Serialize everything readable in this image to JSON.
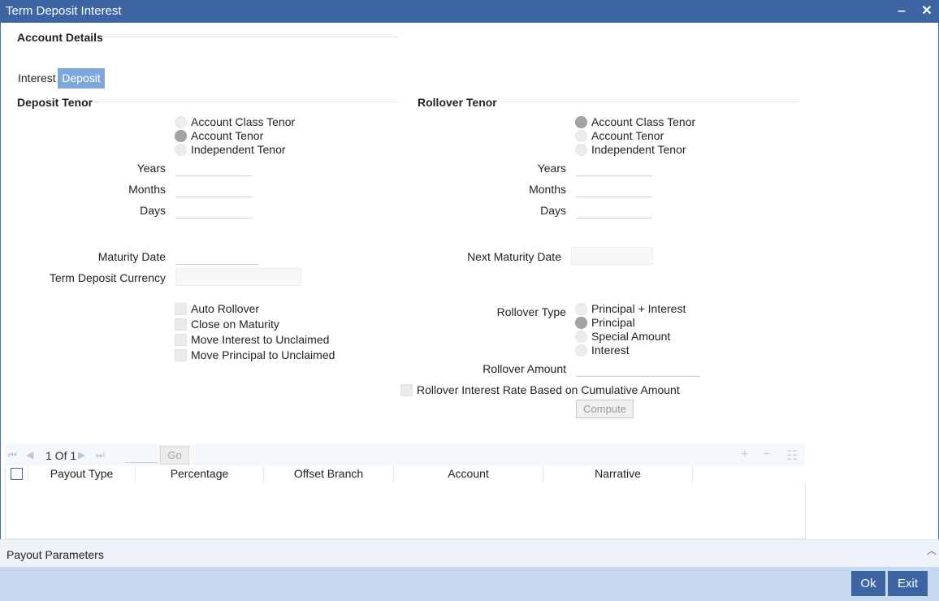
{
  "window": {
    "title": "Term Deposit Interest",
    "minimize": "‒",
    "close": "✕"
  },
  "account_details": {
    "heading": "Account Details"
  },
  "tabs": [
    {
      "label": "Interest"
    },
    {
      "label": "Deposit",
      "active": true
    }
  ],
  "deposit_tenor": {
    "heading": "Deposit Tenor",
    "options": [
      {
        "label": "Account Class Tenor",
        "selected": false
      },
      {
        "label": "Account Tenor",
        "selected": true
      },
      {
        "label": "Independent Tenor",
        "selected": false
      }
    ],
    "years_label": "Years",
    "months_label": "Months",
    "days_label": "Days",
    "years": "",
    "months": "",
    "days": ""
  },
  "rollover_tenor": {
    "heading": "Rollover Tenor",
    "options": [
      {
        "label": "Account Class Tenor",
        "selected": true
      },
      {
        "label": "Account Tenor",
        "selected": false
      },
      {
        "label": "Independent Tenor",
        "selected": false
      }
    ],
    "years_label": "Years",
    "months_label": "Months",
    "days_label": "Days",
    "years": "",
    "months": "",
    "days": ""
  },
  "maturity": {
    "maturity_date_label": "Maturity Date",
    "maturity_date": "",
    "currency_label": "Term Deposit Currency",
    "currency": "",
    "next_maturity_label": "Next Maturity Date",
    "next_maturity": ""
  },
  "checkboxes": [
    {
      "label": "Auto Rollover",
      "checked": false
    },
    {
      "label": "Close on Maturity",
      "checked": false
    },
    {
      "label": "Move Interest to Unclaimed",
      "checked": false
    },
    {
      "label": "Move Principal to Unclaimed",
      "checked": false
    }
  ],
  "rollover_type": {
    "label": "Rollover Type",
    "options": [
      {
        "label": "Principal + Interest",
        "selected": false
      },
      {
        "label": "Principal",
        "selected": true
      },
      {
        "label": "Special Amount",
        "selected": false
      },
      {
        "label": "Interest",
        "selected": false
      }
    ],
    "amount_label": "Rollover Amount",
    "amount": ""
  },
  "cumulative": {
    "label": "Rollover Interest Rate Based on Cumulative Amount",
    "checked": false
  },
  "compute_button": "Compute",
  "pager": {
    "text": "1 Of 1",
    "go": "Go",
    "page_value": ""
  },
  "grid": {
    "columns": [
      "Payout Type",
      "Percentage",
      "Offset Branch",
      "Account",
      "Narrative"
    ],
    "rows": []
  },
  "payout_section": {
    "label": "Payout Parameters",
    "caret": "︿"
  },
  "footer": {
    "ok": "Ok",
    "exit": "Exit"
  },
  "colors": {
    "titlebar": "#3d64a3",
    "active_tab": "#7ba7d9",
    "footer": "#c6d9ee",
    "button": "#3d64a3"
  }
}
